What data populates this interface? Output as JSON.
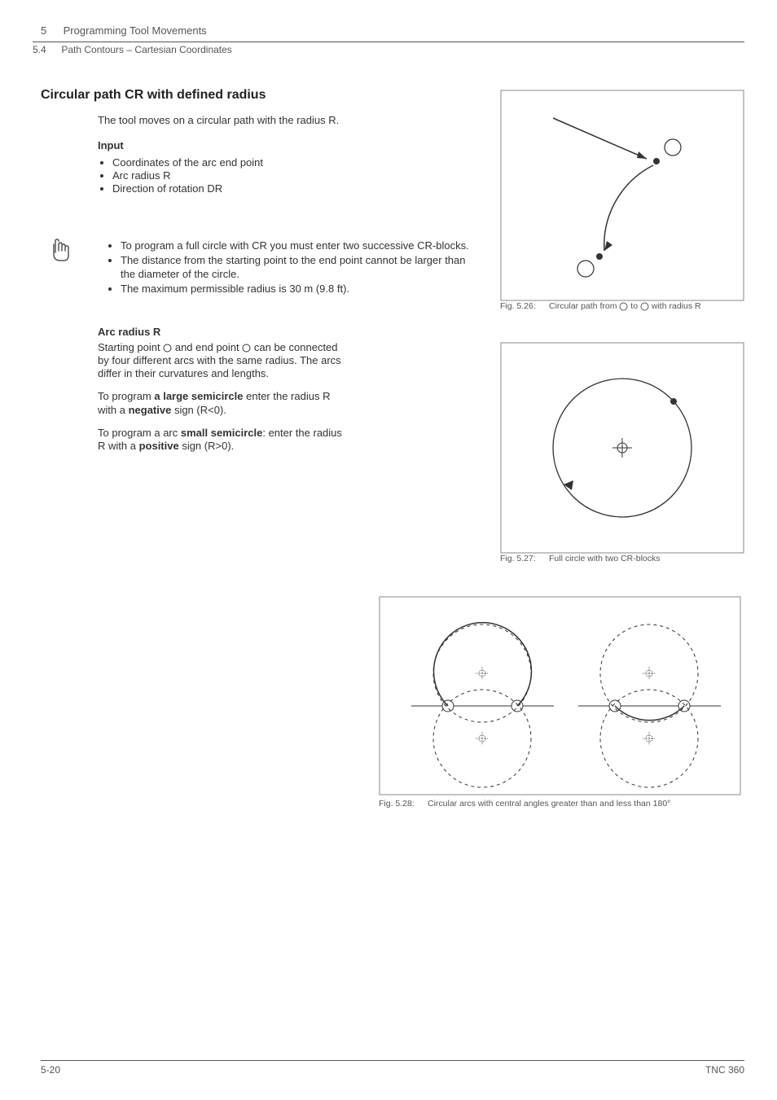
{
  "header": {
    "chapter_num": "5",
    "chapter_title": "Programming Tool Movements",
    "section_num": "5.4",
    "section_title": "Path Contours – Cartesian Coordinates"
  },
  "main": {
    "heading": "Circular path CR with defined radius",
    "intro": "The tool moves on a circular path with the radius R.",
    "input_label": "Input",
    "input_items": [
      "Coordinates of the arc end point",
      "Arc radius R",
      "Direction of rotation DR"
    ]
  },
  "fig1": {
    "label": "Fig. 5.26:",
    "text_a": "Circular path from ",
    "text_b": " to ",
    "text_c": " with radius R"
  },
  "notes": [
    "To program a full circle with CR you must enter two successive CR-blocks.",
    "The distance from the starting point to the end point cannot be larger than the diameter of the circle.",
    "The maximum permissible radius is 30 m (9.8 ft)."
  ],
  "fig2": {
    "label": "Fig. 5.27:",
    "text": "Full circle with two CR-blocks"
  },
  "arc": {
    "heading": "Arc radius R",
    "p1_a": "Starting point ",
    "p1_b": " and end point ",
    "p1_c": " can be connected by four different arcs with the same radius. The arcs differ in their curvatures and lengths.",
    "p2_a": "To program ",
    "p2_b": "a large semicircle",
    "p2_c": " enter the radius R with a ",
    "p2_d": "negative",
    "p2_e": " sign (R<0).",
    "p3_a": "To program a arc ",
    "p3_b": "small semicircle",
    "p3_c": ": enter the radius R with a ",
    "p3_d": "positive",
    "p3_e": " sign (R>0)."
  },
  "fig3": {
    "label": "Fig. 5.28:",
    "text": "Circular arcs with central angles greater than and less than 180°"
  },
  "footer": {
    "page": "5-20",
    "model": "TNC 360"
  }
}
